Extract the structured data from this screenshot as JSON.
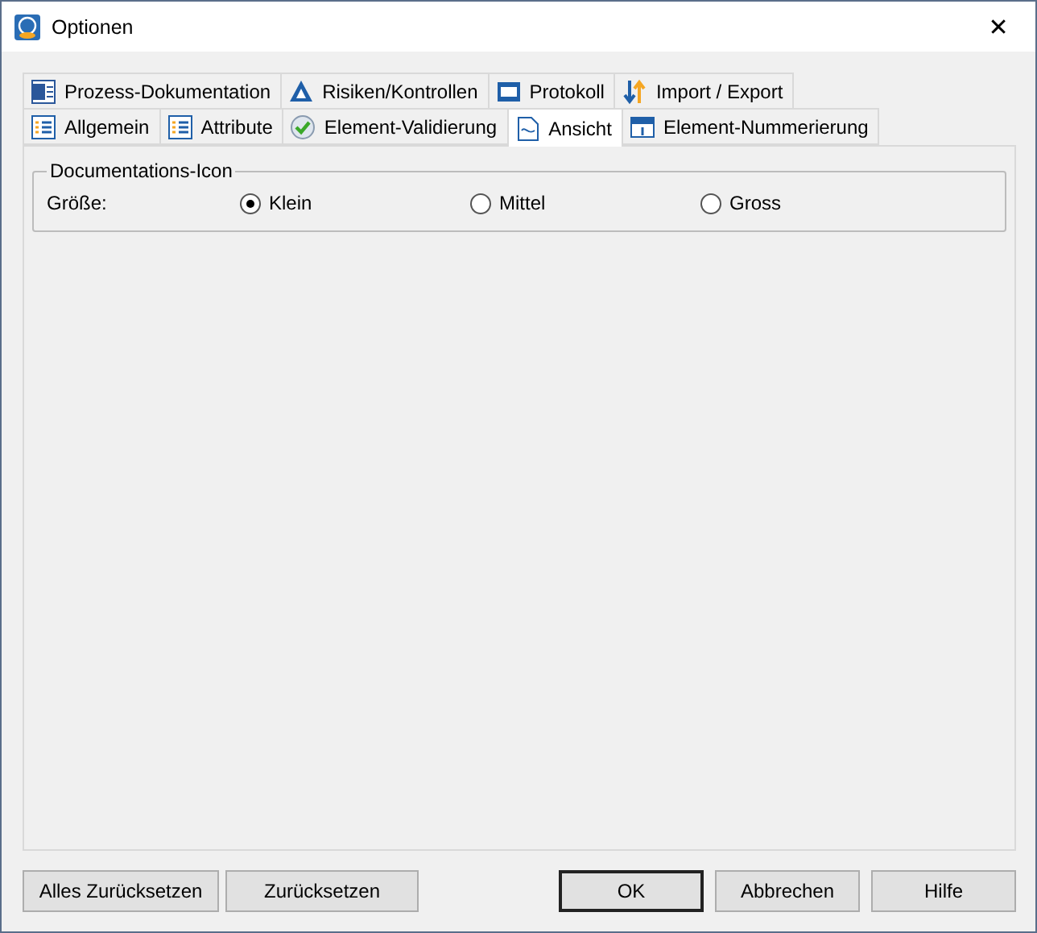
{
  "window": {
    "title": "Optionen",
    "close": "✕"
  },
  "tab_rows": [
    [
      {
        "label": "Prozess-Dokumentation",
        "kind": "word",
        "selected": false
      },
      {
        "label": "Risiken/Kontrollen",
        "kind": "triangle",
        "selected": false
      },
      {
        "label": "Protokoll",
        "kind": "window",
        "selected": false
      },
      {
        "label": "Import / Export",
        "kind": "arrows",
        "selected": false
      }
    ],
    [
      {
        "label": "Allgemein",
        "kind": "list",
        "selected": false
      },
      {
        "label": "Attribute",
        "kind": "list",
        "selected": false
      },
      {
        "label": "Element-Validierung",
        "kind": "check",
        "selected": false
      },
      {
        "label": "Ansicht",
        "kind": "doc",
        "selected": true
      },
      {
        "label": "Element-Nummerierung",
        "kind": "calendar",
        "selected": false
      }
    ]
  ],
  "group": {
    "title": "Documentations-Icon",
    "label": "Größe:",
    "options": [
      {
        "label": "Klein",
        "selected": true
      },
      {
        "label": "Mittel",
        "selected": false
      },
      {
        "label": "Gross",
        "selected": false
      }
    ]
  },
  "buttons_left": [
    "Alles Zurücksetzen",
    "Zurücksetzen"
  ],
  "buttons_right": [
    {
      "label": "OK",
      "default": true
    },
    {
      "label": "Abbrechen",
      "default": false
    },
    {
      "label": "Hilfe",
      "default": false
    }
  ]
}
